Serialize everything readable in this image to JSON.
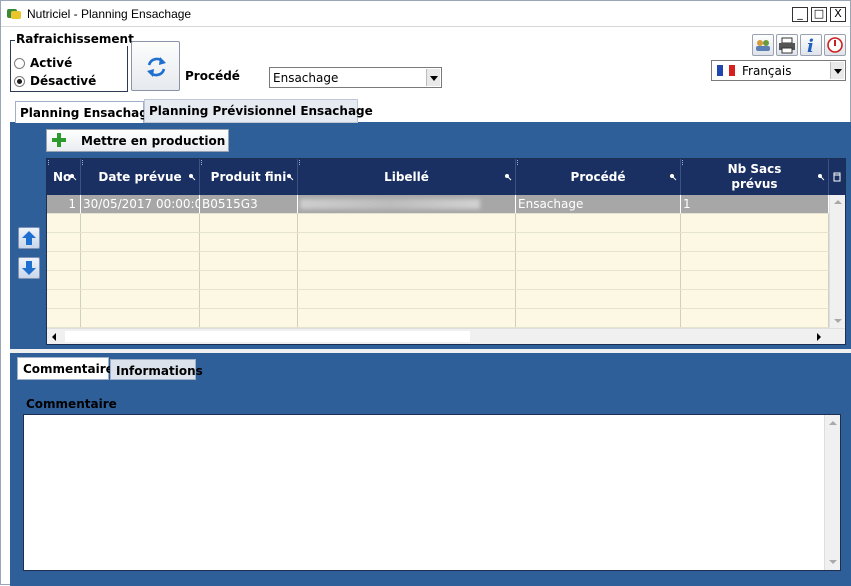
{
  "window": {
    "title": "Nutriciel - Planning Ensachage",
    "minimize": "_",
    "maximize": "□",
    "close": "X"
  },
  "refresh": {
    "legend": "Rafraichissement",
    "options": [
      "Activé",
      "Désactivé"
    ],
    "selected": "Désactivé"
  },
  "procede": {
    "label": "Procédé",
    "value": "Ensachage"
  },
  "language": {
    "value": "Français"
  },
  "tabs": [
    "Planning Ensachage",
    "Planning Prévisionnel Ensachage"
  ],
  "active_tab": "Planning Ensachage",
  "toolbar": {
    "mettre_en_production": "Mettre en production"
  },
  "grid": {
    "columns": [
      "No",
      "Date prévue",
      "Produit fini",
      "Libellé",
      "Procédé",
      "Nb Sacs prévus"
    ],
    "rows": [
      [
        "1",
        "30/05/2017 00:00:0",
        "B0515G3",
        "",
        "Ensachage",
        "1"
      ]
    ],
    "empty_rows": 7
  },
  "subtabs": [
    "Commentaire",
    "Informations"
  ],
  "active_subtab": "Commentaire",
  "comment": {
    "label": "Commentaire",
    "value": ""
  },
  "colors": {
    "panel_blue": "#2f5f99",
    "header_navy": "#1a2f62",
    "selected_row": "#a7a7a7",
    "empty_row": "#fdf8e4"
  }
}
